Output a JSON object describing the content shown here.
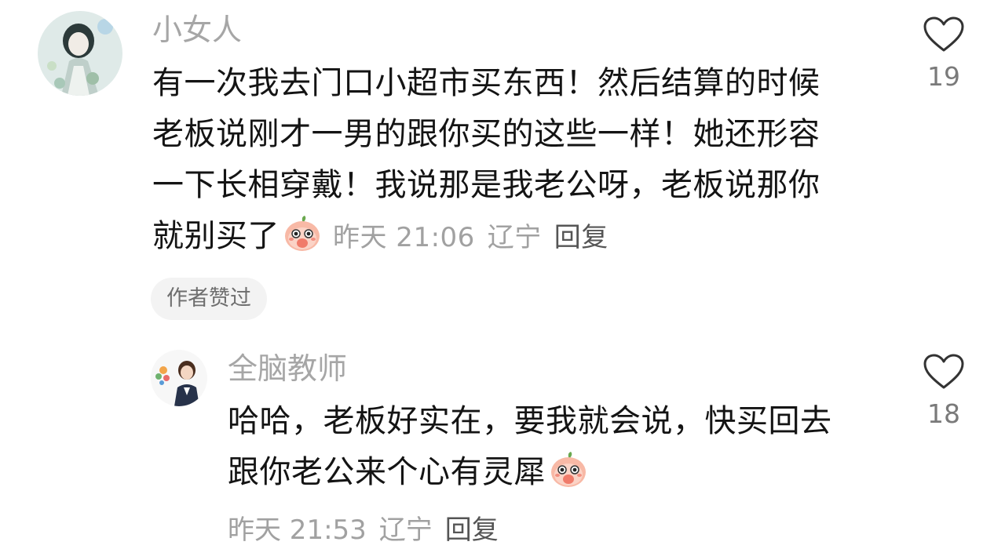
{
  "comments": [
    {
      "username": "小女人",
      "lines": [
        "有一次我去门口小超市买东西！然后结算的时候",
        "老板说刚才一男的跟你买的这些一样！她还形容",
        "一下长相穿戴！我说那是我老公呀，老板说那你",
        "就别买了"
      ],
      "emoji": "shy-peach-emoji",
      "time": "昨天 21:06",
      "location": "辽宁",
      "reply_label": "回复",
      "author_badge": "作者赞过",
      "likes": "19"
    },
    {
      "username": "全脑教师",
      "lines": [
        "哈哈，老板好实在，要我就会说，快买回去",
        "跟你老公来个心有灵犀"
      ],
      "emoji": "shy-peach-emoji",
      "time": "昨天 21:53",
      "location": "辽宁",
      "reply_label": "回复",
      "likes": "18"
    }
  ],
  "icons": {
    "like": "heart-outline-icon"
  },
  "colors": {
    "username": "#a6a6a6",
    "text": "#141414",
    "meta": "#a1a1a1",
    "badge_bg": "#f3f3f3"
  }
}
